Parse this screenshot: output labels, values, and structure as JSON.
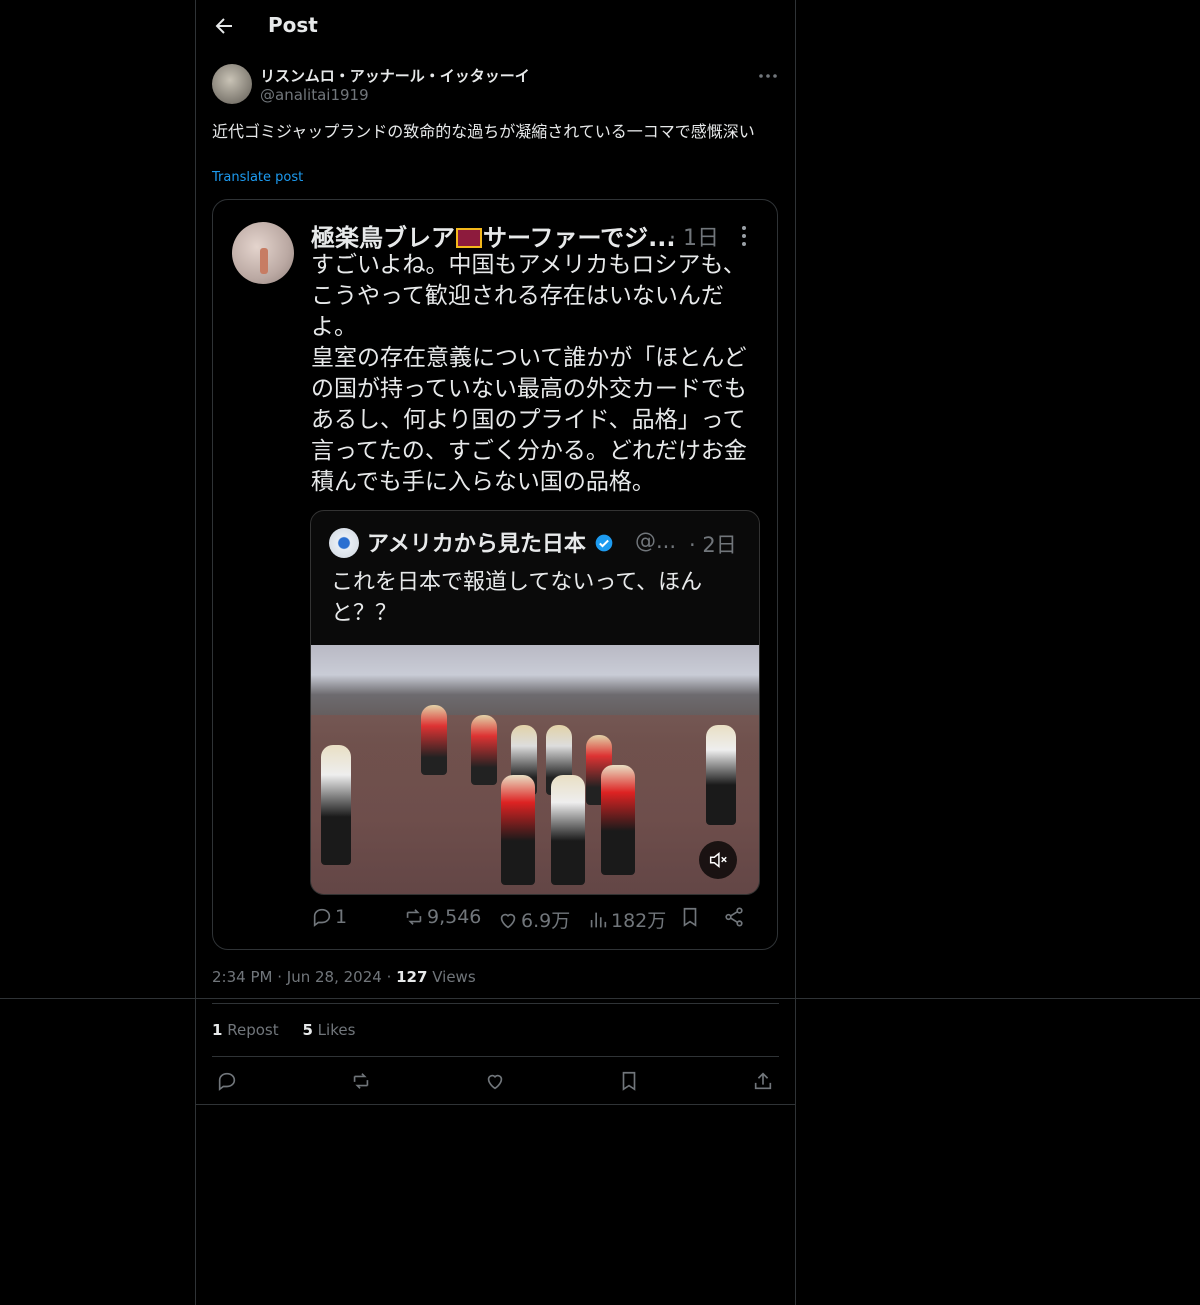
{
  "header": {
    "title": "Post"
  },
  "author": {
    "display_name": "リスンムロ・アッナール・イッタッーイ",
    "handle": "@analitai1919"
  },
  "post": {
    "text": "近代ゴミジャップランドの致命的な過ちが凝縮されている一コマで感慨深い",
    "translate_label": "Translate post"
  },
  "embedded_screenshot": {
    "name_before_flag": "極楽鳥ブレア",
    "name_after_flag": "サーファーでジ...",
    "time": "· 1日",
    "body": "すごいよね。中国もアメリカもロシアも、こうやって歓迎される存在はいないんだよ。\n皇室の存在意義について誰かが「ほとんどの国が持っていない最高の外交カードでもあるし、何より国のプライド、品格」って言ってたの、すごく分かる。どれだけお金積んでも手に入らない国の品格。",
    "quote": {
      "name": "アメリカから見た日本",
      "handle": "@...",
      "time": "· 2日",
      "text": "これを日本で報道してないって、ほんと？？"
    },
    "stats": {
      "replies": "1",
      "reposts": "9,546",
      "likes": "6.9万",
      "views": "182万"
    }
  },
  "meta": {
    "time": "2:34 PM",
    "date": "Jun 28, 2024",
    "views_count": "127",
    "views_label": "Views"
  },
  "engagement": {
    "repost_count": "1",
    "repost_label": "Repost",
    "likes_count": "5",
    "likes_label": "Likes"
  },
  "colors": {
    "background": "#000000",
    "text": "#e7e9ea",
    "muted": "#71767b",
    "accent": "#1d9bf0",
    "border": "#2f3336"
  }
}
